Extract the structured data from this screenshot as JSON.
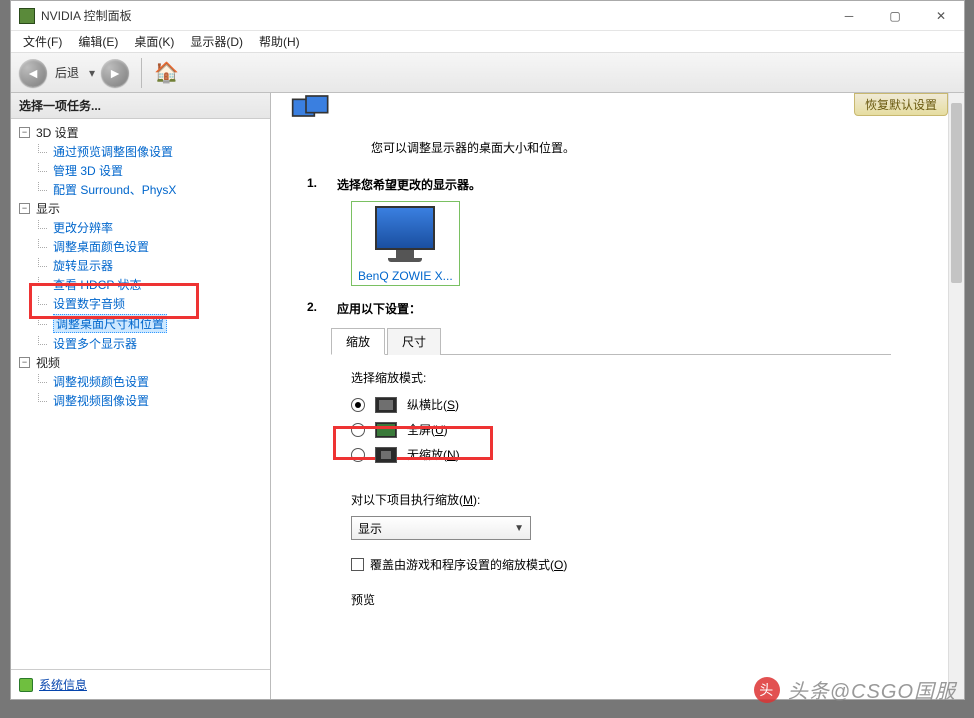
{
  "title": "NVIDIA 控制面板",
  "menus": {
    "file": "文件(F)",
    "edit": "编辑(E)",
    "desktop": "桌面(K)",
    "display": "显示器(D)",
    "help": "帮助(H)"
  },
  "toolbar": {
    "back": "后退"
  },
  "sidebar": {
    "heading": "选择一项任务...",
    "n3d": {
      "label": "3D 设置",
      "items": [
        "通过预览调整图像设置",
        "管理 3D 设置",
        "配置 Surround、PhysX"
      ]
    },
    "display": {
      "label": "显示",
      "items": [
        "更改分辨率",
        "调整桌面颜色设置",
        "旋转显示器",
        "查看 HDCP 状态",
        "设置数字音频",
        "调整桌面尺寸和位置",
        "设置多个显示器"
      ]
    },
    "video": {
      "label": "视频",
      "items": [
        "调整视频颜色设置",
        "调整视频图像设置"
      ]
    },
    "footer": "系统信息"
  },
  "content": {
    "restore": "恢复默认设置",
    "intro": "您可以调整显示器的桌面大小和位置。",
    "step1": {
      "num": "1.",
      "label": "选择您希望更改的显示器。"
    },
    "monitor": "BenQ ZOWIE X...",
    "step2": {
      "num": "2.",
      "label": "应用以下设置："
    },
    "tabs": {
      "scale": "缩放",
      "size": "尺寸"
    },
    "scale_mode_label": "选择缩放模式:",
    "modes": {
      "aspect": {
        "t": "纵横比(",
        "u": "S",
        "r": ")"
      },
      "full": {
        "t": "全屏(",
        "u": "U",
        "r": ")"
      },
      "none": {
        "t": "无缩放(",
        "u": "N",
        "r": ")"
      }
    },
    "perform": {
      "t": "对以下项目执行缩放(",
      "u": "M",
      "r": "):"
    },
    "dd": "显示",
    "override": {
      "t": "覆盖由游戏和程序设置的缩放模式(",
      "u": "O",
      "r": ")"
    },
    "preview": "预览"
  },
  "watermark": "头条@CSGO国服"
}
